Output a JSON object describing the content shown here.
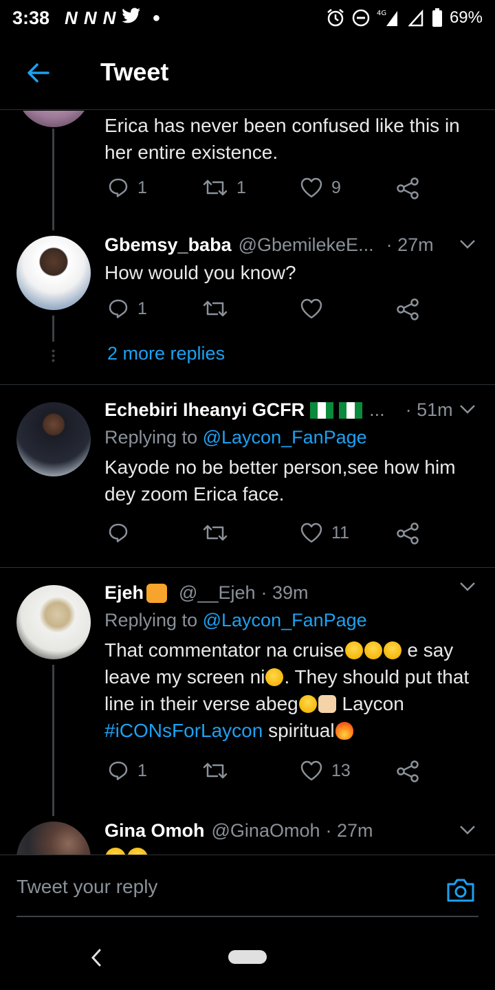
{
  "status_bar": {
    "time": "3:38",
    "notification_letters": [
      "N",
      "N",
      "N"
    ],
    "network": "4G",
    "battery": "69%"
  },
  "header": {
    "title": "Tweet"
  },
  "tweets": [
    {
      "text": "Erica has never been confused like this in her entire existence.",
      "replies": "1",
      "retweets": "1",
      "likes": "9"
    },
    {
      "name": "Gbemsy_baba",
      "handle": "@GbemilekeE...",
      "time": "· 27m",
      "text": "How would you know?",
      "replies": "1",
      "retweets": "",
      "likes": "",
      "more_replies": "2 more replies"
    },
    {
      "name": "Echebiri Iheanyi GCFR",
      "name_suffix": "...",
      "time": "· 51m",
      "replying_prefix": "Replying to",
      "replying_to": "@Laycon_FanPage",
      "text": "Kayode no be better person,see how him dey zoom Erica face.",
      "replies": "",
      "retweets": "",
      "likes": "11"
    },
    {
      "name": "Ejeh",
      "handle": "@__Ejeh",
      "time": "· 39m",
      "replying_prefix": "Replying to",
      "replying_to": "@Laycon_FanPage",
      "text_1": "That commentator na cruise",
      "text_2": " e say leave my screen ni",
      "text_3": ". They should put that line in their verse abeg",
      "text_4": " Laycon ",
      "hashtag": "#iCONsForLaycon",
      "text_5": " spiritual",
      "replies": "1",
      "retweets": "",
      "likes": "13"
    },
    {
      "name": "Gina Omoh",
      "handle": "@GinaOmoh",
      "time": "· 27m"
    }
  ],
  "reply_bar": {
    "placeholder": "Tweet your reply"
  },
  "colors": {
    "accent": "#1da1f2",
    "muted": "#8a9199",
    "background": "#000000"
  }
}
